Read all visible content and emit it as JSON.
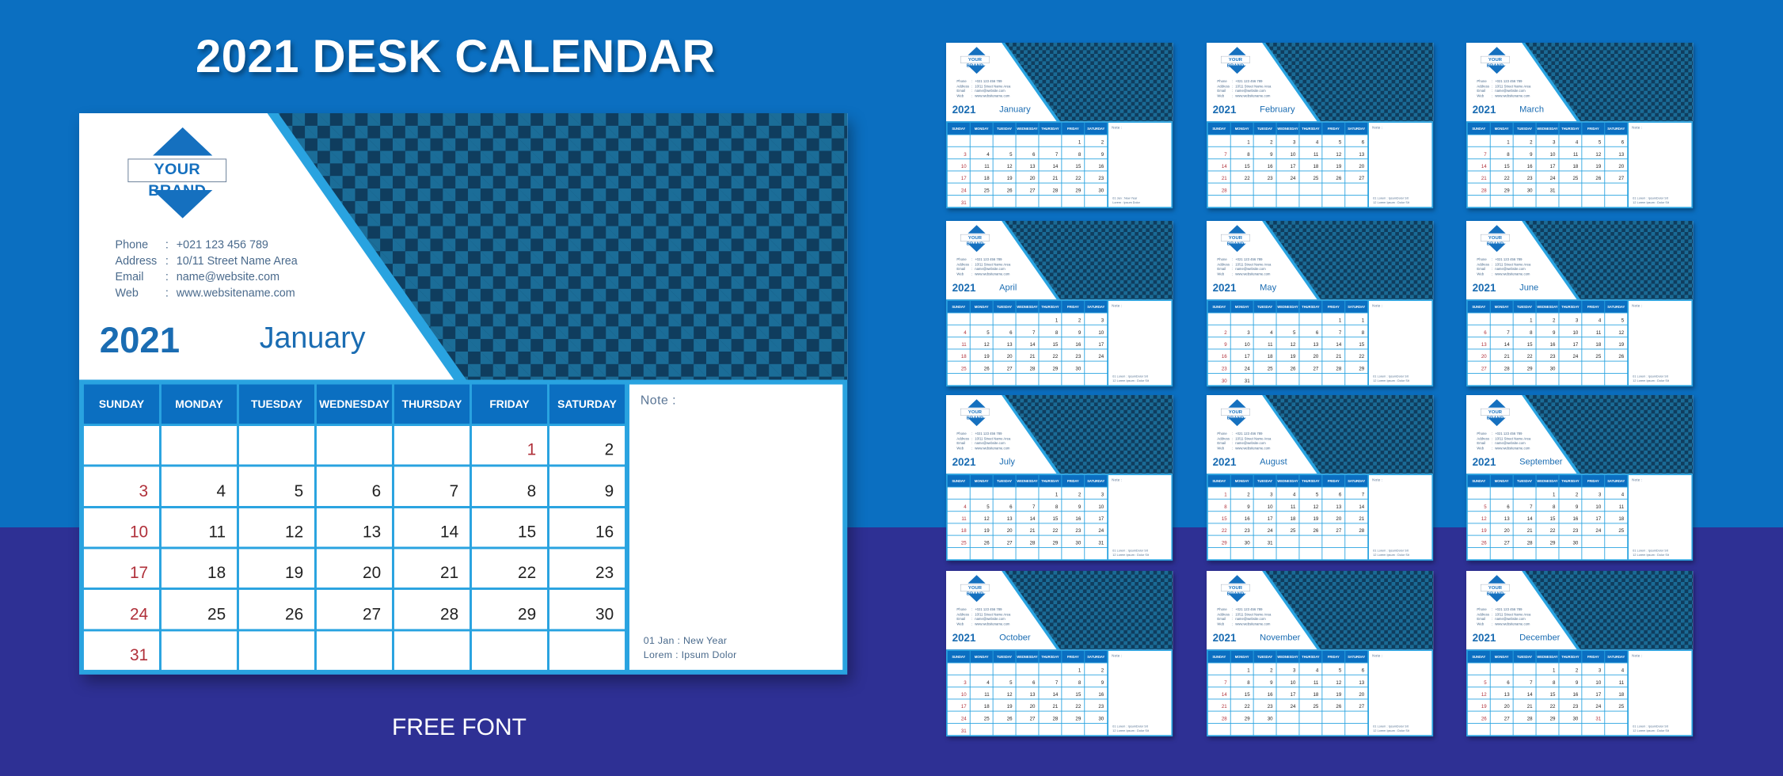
{
  "title": "2021 DESK CALENDAR",
  "caption": "FREE FONT",
  "colors": {
    "background_top": "#0b6fc1",
    "background_bottom": "#2e3094",
    "accent": "#29a3e0",
    "header_blue": "#0b6fc1",
    "holiday_red": "#b0303a"
  },
  "brand": {
    "name": "YOUR BRAND",
    "icon": "diamond-logo-icon"
  },
  "contacts": [
    {
      "label": "Phone",
      "value": "+021 123 456 789"
    },
    {
      "label": "Address",
      "value": "10/11 Street Name Area"
    },
    {
      "label": "Email",
      "value": "name@website.com"
    },
    {
      "label": "Web",
      "value": "www.websitename.com"
    }
  ],
  "weekdays": [
    "SUNDAY",
    "MONDAY",
    "TUESDAY",
    "WEDNESDAY",
    "THURSDAY",
    "FRIDAY",
    "SATURDAY"
  ],
  "year": "2021",
  "note_label": "Note :",
  "main": {
    "month": "January",
    "events": [
      "01 Jan : New Year",
      "Lorem : Ipsum Dolor"
    ],
    "cells": [
      "",
      "",
      "",
      "",
      "",
      "1",
      "2",
      "3",
      "4",
      "5",
      "6",
      "7",
      "8",
      "9",
      "10",
      "11",
      "12",
      "13",
      "14",
      "15",
      "16",
      "17",
      "18",
      "19",
      "20",
      "21",
      "22",
      "23",
      "24",
      "25",
      "26",
      "27",
      "28",
      "29",
      "30",
      "31",
      "",
      "",
      "",
      "",
      "",
      "",
      ""
    ],
    "red": [
      "1"
    ]
  },
  "thumbnails": [
    {
      "month": "January",
      "cells": [
        "",
        "",
        "",
        "",
        "",
        "1",
        "2",
        "3",
        "4",
        "5",
        "6",
        "7",
        "8",
        "9",
        "10",
        "11",
        "12",
        "13",
        "14",
        "15",
        "16",
        "17",
        "18",
        "19",
        "20",
        "21",
        "22",
        "23",
        "24",
        "25",
        "26",
        "27",
        "28",
        "29",
        "30",
        "31",
        "",
        "",
        "",
        "",
        "",
        ""
      ],
      "events": [
        "01 Jan : New Year",
        "Lorem : Ipsum Dolor"
      ]
    },
    {
      "month": "February",
      "cells": [
        "",
        "1",
        "2",
        "3",
        "4",
        "5",
        "6",
        "7",
        "8",
        "9",
        "10",
        "11",
        "12",
        "13",
        "14",
        "15",
        "16",
        "17",
        "18",
        "19",
        "20",
        "21",
        "22",
        "23",
        "24",
        "25",
        "26",
        "27",
        "28",
        "",
        "",
        "",
        "",
        "",
        "",
        "",
        "",
        "",
        "",
        "",
        "",
        ""
      ],
      "events": [
        "01 Lorem : IpsumDolor Sit",
        "12 Lorem Ipsum : Dolor Sit"
      ]
    },
    {
      "month": "March",
      "cells": [
        "",
        "1",
        "2",
        "3",
        "4",
        "5",
        "6",
        "7",
        "8",
        "9",
        "10",
        "11",
        "12",
        "13",
        "14",
        "15",
        "16",
        "17",
        "18",
        "19",
        "20",
        "21",
        "22",
        "23",
        "24",
        "25",
        "26",
        "27",
        "28",
        "29",
        "30",
        "31",
        "",
        "",
        "",
        "",
        "",
        "",
        "",
        "",
        "",
        ""
      ],
      "events": [
        "01 Lorem : IpsumDolor Sit",
        "12 Lorem Ipsum : Dolor Sit"
      ]
    },
    {
      "month": "April",
      "cells": [
        "",
        "",
        "",
        "",
        "1",
        "2",
        "3",
        "4",
        "5",
        "6",
        "7",
        "8",
        "9",
        "10",
        "11",
        "12",
        "13",
        "14",
        "15",
        "16",
        "17",
        "18",
        "19",
        "20",
        "21",
        "22",
        "23",
        "24",
        "25",
        "26",
        "27",
        "28",
        "29",
        "30",
        "",
        "",
        "",
        "",
        "",
        "",
        "",
        ""
      ],
      "events": [
        "01 Lorem : IpsumDolor Sit",
        "12 Lorem Ipsum : Dolor Sit"
      ]
    },
    {
      "month": "May",
      "cells": [
        "",
        "",
        "",
        "",
        "",
        "1",
        "1",
        "2",
        "3",
        "4",
        "5",
        "6",
        "7",
        "8",
        "9",
        "10",
        "11",
        "12",
        "13",
        "14",
        "15",
        "16",
        "17",
        "18",
        "19",
        "20",
        "21",
        "22",
        "23",
        "24",
        "25",
        "26",
        "27",
        "28",
        "29",
        "30",
        "31",
        "",
        "",
        "",
        "",
        ""
      ],
      "events": [
        "01 Lorem : IpsumDolor Sit",
        "12 Lorem Ipsum : Dolor Sit"
      ]
    },
    {
      "month": "June",
      "cells": [
        "",
        "",
        "1",
        "2",
        "3",
        "4",
        "5",
        "6",
        "7",
        "8",
        "9",
        "10",
        "11",
        "12",
        "13",
        "14",
        "15",
        "16",
        "17",
        "18",
        "19",
        "20",
        "21",
        "22",
        "23",
        "24",
        "25",
        "26",
        "27",
        "28",
        "29",
        "30",
        "",
        "",
        "",
        "",
        "",
        "",
        "",
        "",
        "",
        ""
      ],
      "events": [
        "01 Lorem : IpsumDolor Sit",
        "12 Lorem Ipsum : Dolor Sit"
      ]
    },
    {
      "month": "July",
      "cells": [
        "",
        "",
        "",
        "",
        "1",
        "2",
        "3",
        "4",
        "5",
        "6",
        "7",
        "8",
        "9",
        "10",
        "11",
        "12",
        "13",
        "14",
        "15",
        "16",
        "17",
        "18",
        "19",
        "20",
        "21",
        "22",
        "23",
        "24",
        "25",
        "26",
        "27",
        "28",
        "29",
        "30",
        "31",
        "",
        "",
        "",
        "",
        "",
        "",
        ""
      ],
      "events": [
        "01 Lorem : IpsumDolor Sit",
        "12 Lorem Ipsum : Dolor Sit"
      ]
    },
    {
      "month": "August",
      "cells": [
        "1",
        "2",
        "3",
        "4",
        "5",
        "6",
        "7",
        "8",
        "9",
        "10",
        "11",
        "12",
        "13",
        "14",
        "15",
        "16",
        "17",
        "18",
        "19",
        "20",
        "21",
        "22",
        "23",
        "24",
        "25",
        "26",
        "27",
        "28",
        "29",
        "30",
        "31",
        "",
        "",
        "",
        "",
        "",
        "",
        "",
        "",
        "",
        "",
        ""
      ],
      "events": [
        "01 Lorem : IpsumDolor Sit",
        "12 Lorem Ipsum : Dolor Sit"
      ]
    },
    {
      "month": "September",
      "cells": [
        "",
        "",
        "",
        "1",
        "2",
        "3",
        "4",
        "5",
        "6",
        "7",
        "8",
        "9",
        "10",
        "11",
        "12",
        "13",
        "14",
        "15",
        "16",
        "17",
        "18",
        "19",
        "20",
        "21",
        "22",
        "23",
        "24",
        "25",
        "26",
        "27",
        "28",
        "29",
        "30",
        "",
        "",
        "",
        "",
        "",
        "",
        "",
        "",
        ""
      ],
      "events": [
        "01 Lorem : IpsumDolor Sit",
        "12 Lorem Ipsum : Dolor Sit"
      ]
    },
    {
      "month": "October",
      "cells": [
        "",
        "",
        "",
        "",
        "",
        "1",
        "2",
        "3",
        "4",
        "5",
        "6",
        "7",
        "8",
        "9",
        "10",
        "11",
        "12",
        "13",
        "14",
        "15",
        "16",
        "17",
        "18",
        "19",
        "20",
        "21",
        "22",
        "23",
        "24",
        "25",
        "26",
        "27",
        "28",
        "29",
        "30",
        "31",
        "",
        "",
        "",
        "",
        "",
        ""
      ],
      "events": [
        "01 Lorem : IpsumDolor Sit",
        "12 Lorem Ipsum : Dolor Sit"
      ]
    },
    {
      "month": "November",
      "cells": [
        "",
        "1",
        "2",
        "3",
        "4",
        "5",
        "6",
        "7",
        "8",
        "9",
        "10",
        "11",
        "12",
        "13",
        "14",
        "15",
        "16",
        "17",
        "18",
        "19",
        "20",
        "21",
        "22",
        "23",
        "24",
        "25",
        "26",
        "27",
        "28",
        "29",
        "30",
        "",
        "",
        "",
        "",
        "",
        "",
        "",
        "",
        "",
        "",
        ""
      ],
      "events": [
        "01 Lorem : IpsumDolor Sit",
        "12 Lorem Ipsum : Dolor Sit"
      ]
    },
    {
      "month": "December",
      "cells": [
        "",
        "",
        "",
        "1",
        "2",
        "3",
        "4",
        "5",
        "6",
        "7",
        "8",
        "9",
        "10",
        "11",
        "12",
        "13",
        "14",
        "15",
        "16",
        "17",
        "18",
        "19",
        "20",
        "21",
        "22",
        "23",
        "24",
        "25",
        "26",
        "27",
        "28",
        "29",
        "30",
        "31",
        "",
        "",
        "",
        "",
        "",
        "",
        "",
        ""
      ],
      "events": [
        "01 Lorem : IpsumDolor Sit",
        "12 Lorem Ipsum : Dolor Sit"
      ],
      "red_extra": [
        "31"
      ]
    }
  ]
}
